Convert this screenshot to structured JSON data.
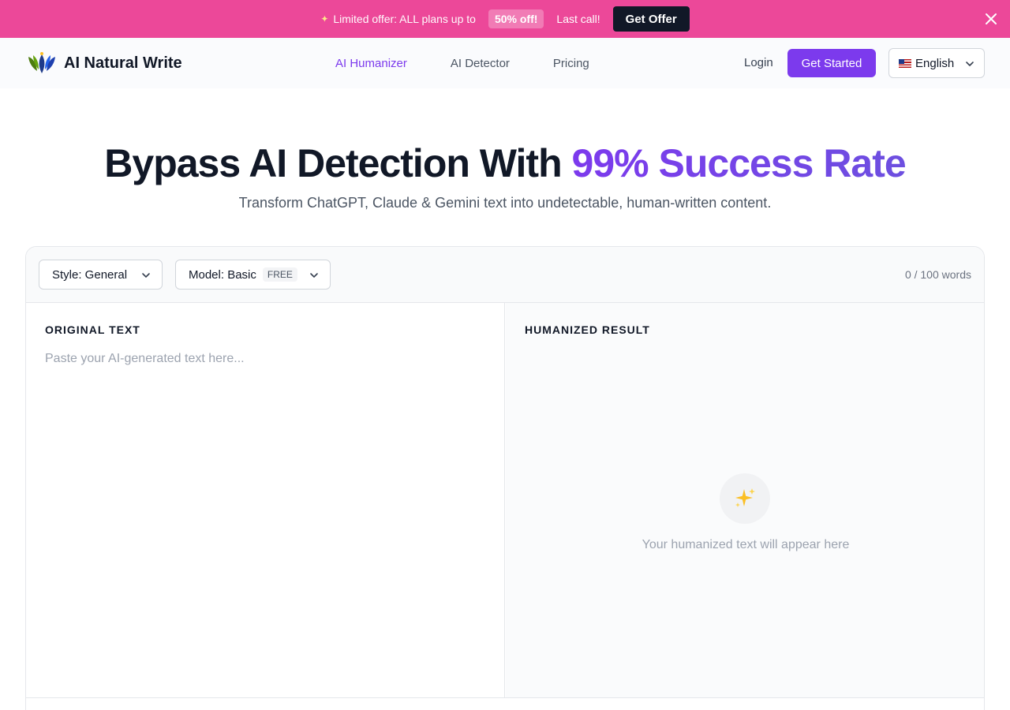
{
  "promo": {
    "sparkle": "✦",
    "text": "Limited offer: ALL plans up to",
    "badge": "50% off!",
    "last_call": "Last call!",
    "cta": "Get Offer"
  },
  "header": {
    "brand_name": "AI Natural Write",
    "nav": [
      {
        "label": "AI Humanizer",
        "active": true
      },
      {
        "label": "AI Detector",
        "active": false
      },
      {
        "label": "Pricing",
        "active": false
      }
    ],
    "login": "Login",
    "get_started": "Get Started",
    "language": "English"
  },
  "hero": {
    "title_main": "Bypass AI Detection With ",
    "title_accent": "99% Success Rate",
    "subtitle": "Transform ChatGPT, Claude & Gemini text into undetectable, human-written content."
  },
  "editor": {
    "style_label": "Style: General",
    "model_label": "Model: Basic",
    "model_badge": "FREE",
    "word_count": "0 / 100 words",
    "original_label": "ORIGINAL TEXT",
    "original_placeholder": "Paste your AI-generated text here...",
    "original_value": "",
    "result_label": "HUMANIZED RESULT",
    "result_empty_icon": "✨",
    "result_empty_text": "Your humanized text will appear here"
  },
  "colors": {
    "promo_bg": "#ec4899",
    "accent": "#7c3aed",
    "dark": "#111827"
  },
  "icons": [
    "sparkle-icon",
    "close-icon",
    "logo-icon",
    "us-flag-icon",
    "chevron-down-icon",
    "sparkles-icon"
  ]
}
